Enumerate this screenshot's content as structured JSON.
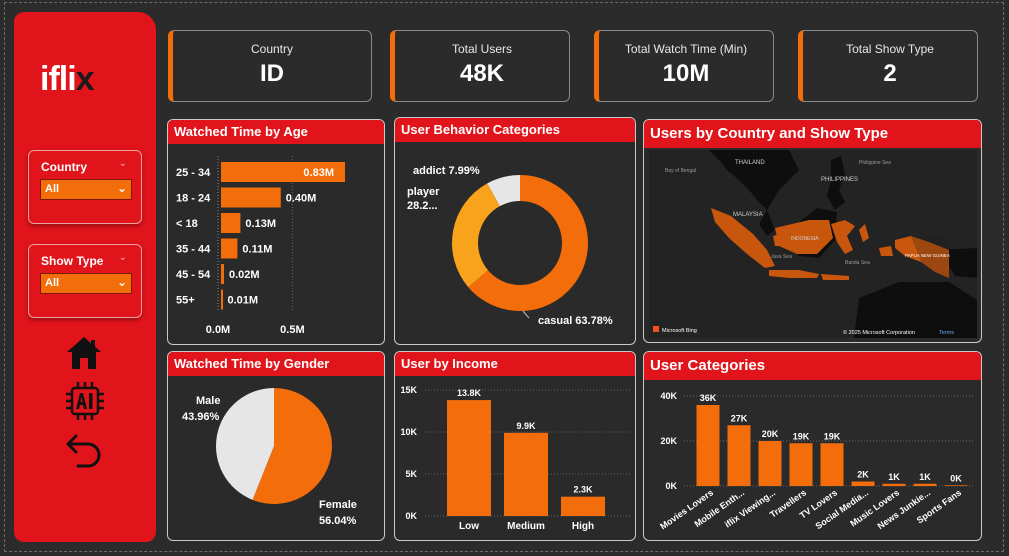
{
  "app": {
    "logo_main": "ifli",
    "logo_accent": "x"
  },
  "slicers": [
    {
      "title": "Country",
      "value": "All"
    },
    {
      "title": "Show Type",
      "value": "All"
    }
  ],
  "nav": [
    {
      "icon": "home-icon"
    },
    {
      "icon": "ai-chip-icon"
    },
    {
      "icon": "back-arrow-icon"
    }
  ],
  "kpis": [
    {
      "label": "Country",
      "value": "ID"
    },
    {
      "label": "Total Users",
      "value": "48K"
    },
    {
      "label": "Total Watch Time (Min)",
      "value": "10M"
    },
    {
      "label": "Total Show Type",
      "value": "2"
    }
  ],
  "panels": {
    "age": "Watched Time by Age",
    "behavior": "User Behavior Categories",
    "map": "Users by Country and Show Type",
    "gender": "Watched Time by Gender",
    "income": "User by Income",
    "categories": "User Categories"
  },
  "map_labels": {
    "thailand": "THAILAND",
    "philippines": "PHILIPPINES",
    "malaysia": "MALAYSIA",
    "indonesia": "INDONESIA",
    "png": "PAPUA NEW GUINEA",
    "bengal": "Bay of Bengal",
    "philippine_sea": "Philippine Sea",
    "java_sea": "Java Sea",
    "banda_sea": "Banda Sea",
    "credit": "Microsoft Bing",
    "copyright": "© 2025 Microsoft Corporation",
    "terms": "Terms"
  },
  "colors": {
    "accent": "#f36d0a",
    "brand": "#e1141b",
    "accent_light": "#f9a21b",
    "grey": "#e6e6e6"
  },
  "chart_data": [
    {
      "id": "age",
      "type": "bar",
      "orientation": "horizontal",
      "title": "Watched Time by Age",
      "categories": [
        "25 - 34",
        "18 - 24",
        "< 18",
        "35 - 44",
        "45 - 54",
        "55+"
      ],
      "values": [
        0.83,
        0.4,
        0.13,
        0.11,
        0.02,
        0.01
      ],
      "data_labels": [
        "0.83M",
        "0.40M",
        "0.13M",
        "0.11M",
        "0.02M",
        "0.01M"
      ],
      "x_ticks": [
        "0.0M",
        "0.5M"
      ],
      "xlim": [
        0,
        0.83
      ]
    },
    {
      "id": "behavior",
      "type": "pie",
      "style": "donut",
      "title": "User Behavior Categories",
      "slices": [
        {
          "label": "casual",
          "value": 63.78,
          "display": "casual 63.78%"
        },
        {
          "label": "player",
          "value": 28.23,
          "display": "player\n28.2..."
        },
        {
          "label": "addict",
          "value": 7.99,
          "display": "addict 7.99%"
        }
      ]
    },
    {
      "id": "gender",
      "type": "pie",
      "title": "Watched Time by Gender",
      "slices": [
        {
          "label": "Female",
          "value": 56.04,
          "display": "Female\n56.04%"
        },
        {
          "label": "Male",
          "value": 43.96,
          "display": "Male\n43.96%"
        }
      ]
    },
    {
      "id": "income",
      "type": "bar",
      "title": "User by Income",
      "categories": [
        "Low",
        "Medium",
        "High"
      ],
      "values": [
        13.8,
        9.9,
        2.3
      ],
      "data_labels": [
        "13.8K",
        "9.9K",
        "2.3K"
      ],
      "y_ticks": [
        "0K",
        "5K",
        "10K",
        "15K"
      ],
      "ylim": [
        0,
        15
      ],
      "grid": true
    },
    {
      "id": "categories",
      "type": "bar",
      "title": "User Categories",
      "categories": [
        "Movies Lovers",
        "Mobile Enth...",
        "iflix Viewing...",
        "Travellers",
        "TV Lovers",
        "Social Media...",
        "Music Lovers",
        "News Junkie...",
        "Sports Fans"
      ],
      "values": [
        36,
        27,
        20,
        19,
        19,
        2,
        1,
        1,
        0.3
      ],
      "data_labels": [
        "36K",
        "27K",
        "20K",
        "19K",
        "19K",
        "2K",
        "1K",
        "1K",
        "0K"
      ],
      "y_ticks": [
        "0K",
        "20K",
        "40K"
      ],
      "ylim": [
        0,
        40
      ],
      "grid": true
    }
  ]
}
